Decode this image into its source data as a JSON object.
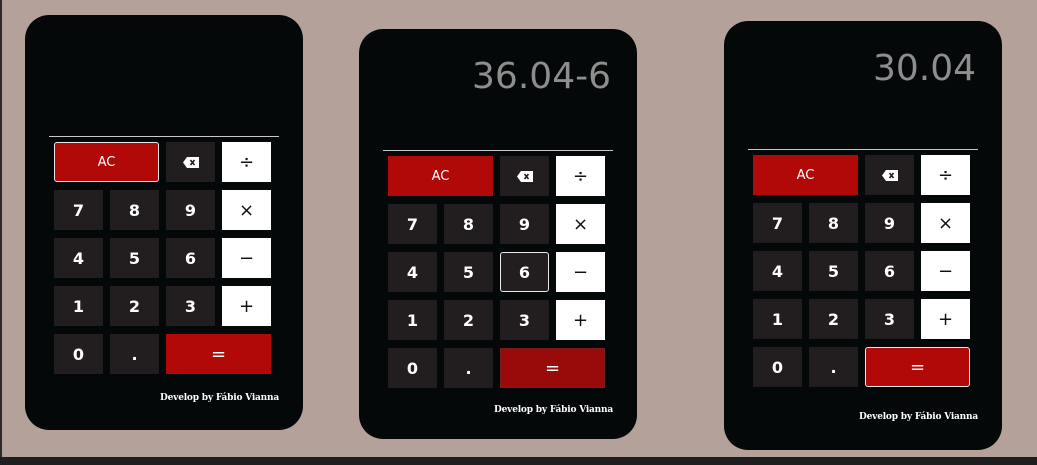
{
  "calculators": [
    {
      "display": "",
      "keys": {
        "ac": "AC",
        "divide": "÷",
        "multiply": "×",
        "minus": "−",
        "plus": "+",
        "seven": "7",
        "eight": "8",
        "nine": "9",
        "four": "4",
        "five": "5",
        "six": "6",
        "one": "1",
        "two": "2",
        "three": "3",
        "zero": "0",
        "dot": ".",
        "equals": "="
      },
      "credit": "Develop by Fábio Vianna"
    },
    {
      "display": "36.04-6",
      "keys": {
        "ac": "AC",
        "divide": "÷",
        "multiply": "×",
        "minus": "−",
        "plus": "+",
        "seven": "7",
        "eight": "8",
        "nine": "9",
        "four": "4",
        "five": "5",
        "six": "6",
        "one": "1",
        "two": "2",
        "three": "3",
        "zero": "0",
        "dot": ".",
        "equals": "="
      },
      "credit": "Develop by Fábio Vianna"
    },
    {
      "display": "30.04",
      "keys": {
        "ac": "AC",
        "divide": "÷",
        "multiply": "×",
        "minus": "−",
        "plus": "+",
        "seven": "7",
        "eight": "8",
        "nine": "9",
        "four": "4",
        "five": "5",
        "six": "6",
        "one": "1",
        "two": "2",
        "three": "3",
        "zero": "0",
        "dot": ".",
        "equals": "="
      },
      "credit": "Develop by Fábio Vianna"
    }
  ],
  "icons": {
    "backspace": "backspace-icon"
  },
  "colors": {
    "background": "#b4a29a",
    "panel": "#050808",
    "accent_red": "#b10908",
    "key_dark": "#221d1e"
  }
}
